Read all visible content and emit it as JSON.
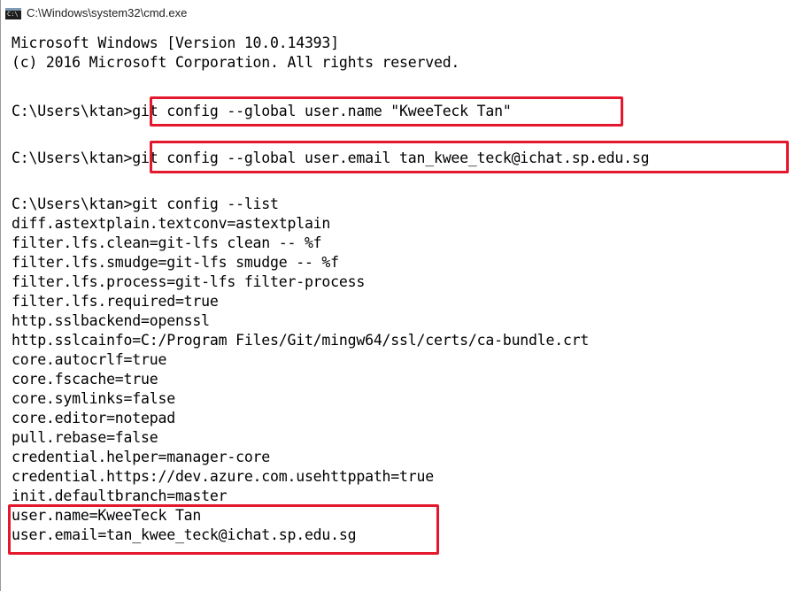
{
  "window": {
    "title": "C:\\Windows\\system32\\cmd.exe",
    "icon": "cmd-console-icon",
    "icon_glyph": "C:\\"
  },
  "console": {
    "lines": [
      "Microsoft Windows [Version 10.0.14393]",
      "(c) 2016 Microsoft Corporation. All rights reserved.",
      "",
      "C:\\Users\\ktan>git config --global user.name \"KweeTeck Tan\"",
      "",
      "C:\\Users\\ktan>git config --global user.email tan_kwee_teck@ichat.sp.edu.sg",
      "",
      "C:\\Users\\ktan>git config --list",
      "diff.astextplain.textconv=astextplain",
      "filter.lfs.clean=git-lfs clean -- %f",
      "filter.lfs.smudge=git-lfs smudge -- %f",
      "filter.lfs.process=git-lfs filter-process",
      "filter.lfs.required=true",
      "http.sslbackend=openssl",
      "http.sslcainfo=C:/Program Files/Git/mingw64/ssl/certs/ca-bundle.crt",
      "core.autocrlf=true",
      "core.fscache=true",
      "core.symlinks=false",
      "core.editor=notepad",
      "pull.rebase=false",
      "credential.helper=manager-core",
      "credential.https://dev.azure.com.usehttppath=true",
      "init.defaultbranch=master",
      "user.name=KweeTeck Tan",
      "user.email=tan_kwee_teck@ichat.sp.edu.sg"
    ]
  },
  "highlight_color": "#e4182c"
}
